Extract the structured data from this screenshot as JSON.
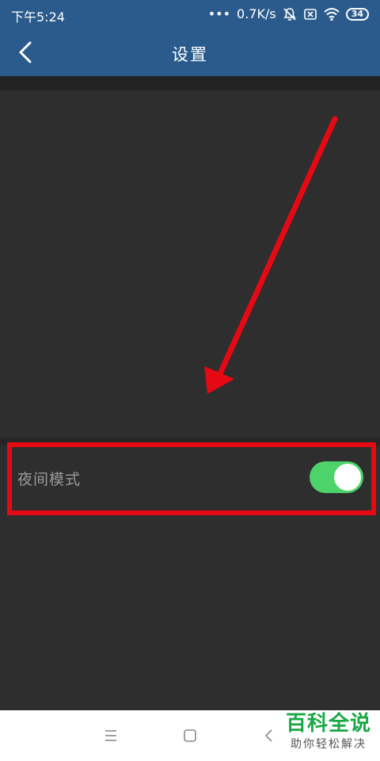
{
  "status_bar": {
    "time": "下午5:24",
    "dots": "•••",
    "speed": "0.7K/s",
    "battery": "34"
  },
  "app_bar": {
    "title": "设置"
  },
  "settings": {
    "night_mode_label": "夜间模式",
    "night_mode_on": true
  },
  "watermark": {
    "main": "百科全说",
    "sub": "助你轻松解决"
  },
  "colors": {
    "header": "#2b5b8c",
    "background": "#2e2e2e",
    "toggle_on": "#4cd46a",
    "annotation": "#e50914",
    "watermark_green": "#1aa845"
  }
}
